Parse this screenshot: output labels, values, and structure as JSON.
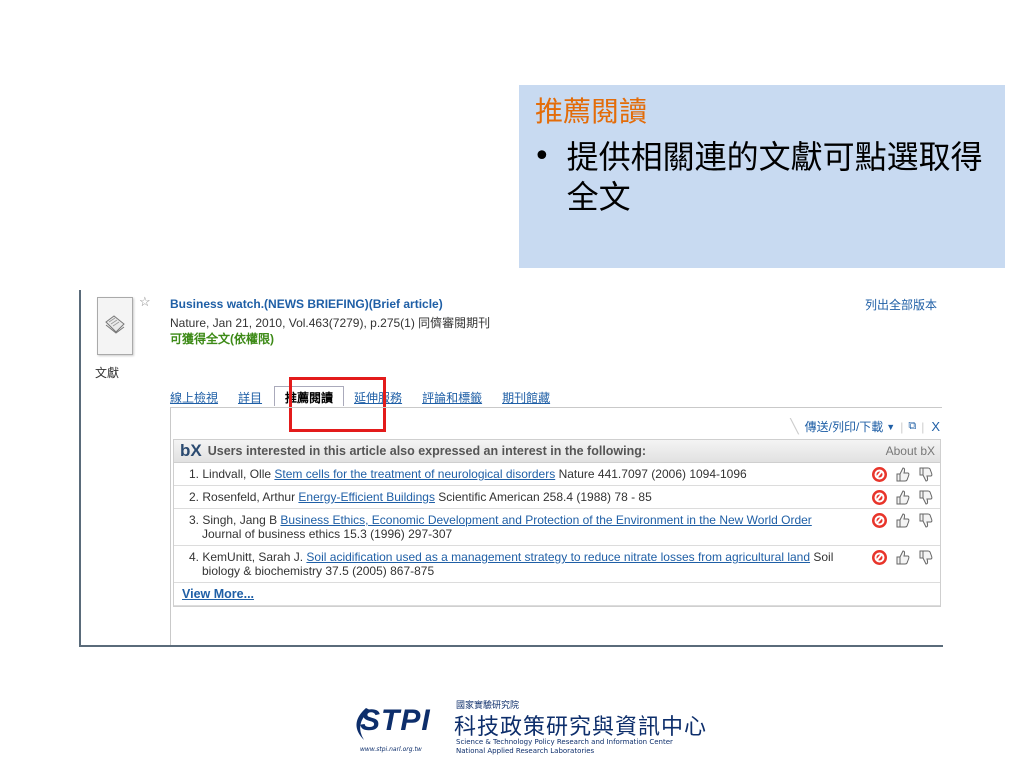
{
  "callout": {
    "title": "推薦閱讀",
    "bullet": "提供相關連的文獻可點選取得全文"
  },
  "record": {
    "doc_type": "文獻",
    "title": "Business watch.(NEWS BRIEFING)(Brief article)",
    "citation": "Nature, Jan 21, 2010, Vol.463(7279), p.275(1) 同儕審閱期刊",
    "availability": "可獲得全文(依權限)",
    "all_versions": "列出全部版本",
    "tabs": [
      "線上檢視",
      "詳目",
      "推薦閱讀",
      "延伸服務",
      "評論和標籤",
      "期刊館藏"
    ],
    "active_tab": "推薦閱讀"
  },
  "toolbar": {
    "send_print": "傳送/列印/下載",
    "close": "X"
  },
  "bx": {
    "logo": "bX",
    "heading": "Users interested in this article also expressed an interest in the following:",
    "about": "About bX",
    "items": [
      {
        "num": "1.",
        "authors": "Lindvall, Olle",
        "title": "Stem cells for the treatment of neurological disorders",
        "source": "Nature 441.7097 (2006) 1094-1096"
      },
      {
        "num": "2.",
        "authors": "Rosenfeld, Arthur",
        "title": "Energy-Efficient Buildings",
        "source": "Scientific American 258.4 (1988) 78 - 85"
      },
      {
        "num": "3.",
        "authors": "Singh, Jang B",
        "title": "Business Ethics, Economic Development and Protection of the Environment in the New World Order",
        "source": "Journal of business ethics 15.3 (1996) 297-307"
      },
      {
        "num": "4.",
        "authors": "KemUnitt, Sarah J.",
        "title": "Soil acidification used as a management strategy to reduce nitrate losses from agricultural land",
        "source": "Soil biology & biochemistry 37.5 (2005) 867-875"
      }
    ],
    "view_more": "View More..."
  },
  "logo": {
    "brand": "STPI",
    "url": "www.stpi.narl.org.tw",
    "institute": "國家實驗研究院",
    "name_cn": "科技政策研究與資訊中心",
    "name_en_1": "Science & Technology Policy Research and Information Center",
    "name_en_2": "National Applied Research Laboratories"
  },
  "colors": {
    "callout_bg": "#c8daf1",
    "callout_title": "#e36c09",
    "link": "#1f5fa6",
    "highlight": "#e31b1b",
    "available": "#3d8a17"
  }
}
